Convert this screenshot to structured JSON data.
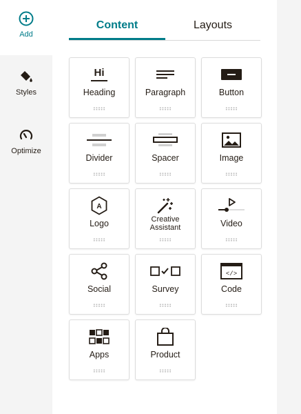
{
  "rail": {
    "add_label": "Add",
    "styles_label": "Styles",
    "optimize_label": "Optimize"
  },
  "tabs": {
    "content": "Content",
    "layouts": "Layouts"
  },
  "blocks": [
    {
      "label": "Heading",
      "icon": "heading-icon"
    },
    {
      "label": "Paragraph",
      "icon": "paragraph-icon"
    },
    {
      "label": "Button",
      "icon": "button-icon"
    },
    {
      "label": "Divider",
      "icon": "divider-icon"
    },
    {
      "label": "Spacer",
      "icon": "spacer-icon"
    },
    {
      "label": "Image",
      "icon": "image-icon"
    },
    {
      "label": "Logo",
      "icon": "logo-icon"
    },
    {
      "label": "Creative Assistant",
      "icon": "magic-wand-icon"
    },
    {
      "label": "Video",
      "icon": "video-icon"
    },
    {
      "label": "Social",
      "icon": "share-icon"
    },
    {
      "label": "Survey",
      "icon": "survey-icon"
    },
    {
      "label": "Code",
      "icon": "code-icon"
    },
    {
      "label": "Apps",
      "icon": "apps-icon"
    },
    {
      "label": "Product",
      "icon": "shopping-bag-icon"
    }
  ],
  "colors": {
    "accent": "#007c89",
    "text": "#241c15",
    "rail_bg": "#f4f4f4"
  },
  "heading_icon_text": "Hi",
  "logo_icon_text": "A",
  "code_icon_text": "</>"
}
